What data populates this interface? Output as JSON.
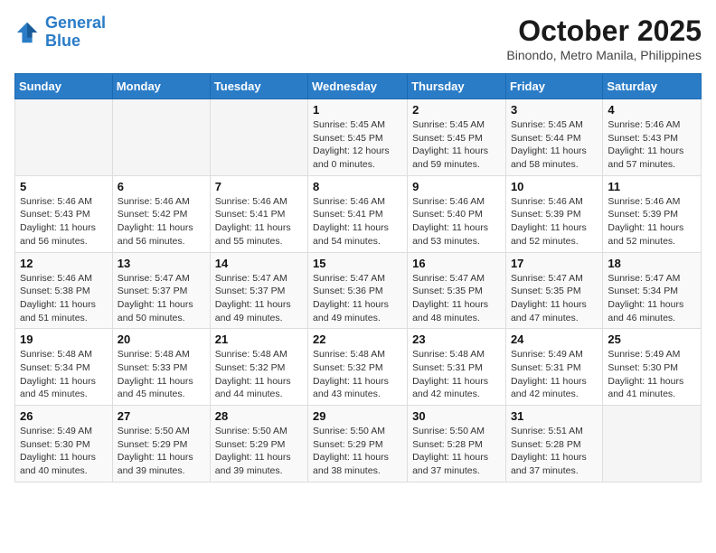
{
  "header": {
    "logo_line1": "General",
    "logo_line2": "Blue",
    "month": "October 2025",
    "location": "Binondo, Metro Manila, Philippines"
  },
  "weekdays": [
    "Sunday",
    "Monday",
    "Tuesday",
    "Wednesday",
    "Thursday",
    "Friday",
    "Saturday"
  ],
  "weeks": [
    [
      {
        "day": "",
        "info": ""
      },
      {
        "day": "",
        "info": ""
      },
      {
        "day": "",
        "info": ""
      },
      {
        "day": "1",
        "info": "Sunrise: 5:45 AM\nSunset: 5:45 PM\nDaylight: 12 hours\nand 0 minutes."
      },
      {
        "day": "2",
        "info": "Sunrise: 5:45 AM\nSunset: 5:45 PM\nDaylight: 11 hours\nand 59 minutes."
      },
      {
        "day": "3",
        "info": "Sunrise: 5:45 AM\nSunset: 5:44 PM\nDaylight: 11 hours\nand 58 minutes."
      },
      {
        "day": "4",
        "info": "Sunrise: 5:46 AM\nSunset: 5:43 PM\nDaylight: 11 hours\nand 57 minutes."
      }
    ],
    [
      {
        "day": "5",
        "info": "Sunrise: 5:46 AM\nSunset: 5:43 PM\nDaylight: 11 hours\nand 56 minutes."
      },
      {
        "day": "6",
        "info": "Sunrise: 5:46 AM\nSunset: 5:42 PM\nDaylight: 11 hours\nand 56 minutes."
      },
      {
        "day": "7",
        "info": "Sunrise: 5:46 AM\nSunset: 5:41 PM\nDaylight: 11 hours\nand 55 minutes."
      },
      {
        "day": "8",
        "info": "Sunrise: 5:46 AM\nSunset: 5:41 PM\nDaylight: 11 hours\nand 54 minutes."
      },
      {
        "day": "9",
        "info": "Sunrise: 5:46 AM\nSunset: 5:40 PM\nDaylight: 11 hours\nand 53 minutes."
      },
      {
        "day": "10",
        "info": "Sunrise: 5:46 AM\nSunset: 5:39 PM\nDaylight: 11 hours\nand 52 minutes."
      },
      {
        "day": "11",
        "info": "Sunrise: 5:46 AM\nSunset: 5:39 PM\nDaylight: 11 hours\nand 52 minutes."
      }
    ],
    [
      {
        "day": "12",
        "info": "Sunrise: 5:46 AM\nSunset: 5:38 PM\nDaylight: 11 hours\nand 51 minutes."
      },
      {
        "day": "13",
        "info": "Sunrise: 5:47 AM\nSunset: 5:37 PM\nDaylight: 11 hours\nand 50 minutes."
      },
      {
        "day": "14",
        "info": "Sunrise: 5:47 AM\nSunset: 5:37 PM\nDaylight: 11 hours\nand 49 minutes."
      },
      {
        "day": "15",
        "info": "Sunrise: 5:47 AM\nSunset: 5:36 PM\nDaylight: 11 hours\nand 49 minutes."
      },
      {
        "day": "16",
        "info": "Sunrise: 5:47 AM\nSunset: 5:35 PM\nDaylight: 11 hours\nand 48 minutes."
      },
      {
        "day": "17",
        "info": "Sunrise: 5:47 AM\nSunset: 5:35 PM\nDaylight: 11 hours\nand 47 minutes."
      },
      {
        "day": "18",
        "info": "Sunrise: 5:47 AM\nSunset: 5:34 PM\nDaylight: 11 hours\nand 46 minutes."
      }
    ],
    [
      {
        "day": "19",
        "info": "Sunrise: 5:48 AM\nSunset: 5:34 PM\nDaylight: 11 hours\nand 45 minutes."
      },
      {
        "day": "20",
        "info": "Sunrise: 5:48 AM\nSunset: 5:33 PM\nDaylight: 11 hours\nand 45 minutes."
      },
      {
        "day": "21",
        "info": "Sunrise: 5:48 AM\nSunset: 5:32 PM\nDaylight: 11 hours\nand 44 minutes."
      },
      {
        "day": "22",
        "info": "Sunrise: 5:48 AM\nSunset: 5:32 PM\nDaylight: 11 hours\nand 43 minutes."
      },
      {
        "day": "23",
        "info": "Sunrise: 5:48 AM\nSunset: 5:31 PM\nDaylight: 11 hours\nand 42 minutes."
      },
      {
        "day": "24",
        "info": "Sunrise: 5:49 AM\nSunset: 5:31 PM\nDaylight: 11 hours\nand 42 minutes."
      },
      {
        "day": "25",
        "info": "Sunrise: 5:49 AM\nSunset: 5:30 PM\nDaylight: 11 hours\nand 41 minutes."
      }
    ],
    [
      {
        "day": "26",
        "info": "Sunrise: 5:49 AM\nSunset: 5:30 PM\nDaylight: 11 hours\nand 40 minutes."
      },
      {
        "day": "27",
        "info": "Sunrise: 5:50 AM\nSunset: 5:29 PM\nDaylight: 11 hours\nand 39 minutes."
      },
      {
        "day": "28",
        "info": "Sunrise: 5:50 AM\nSunset: 5:29 PM\nDaylight: 11 hours\nand 39 minutes."
      },
      {
        "day": "29",
        "info": "Sunrise: 5:50 AM\nSunset: 5:29 PM\nDaylight: 11 hours\nand 38 minutes."
      },
      {
        "day": "30",
        "info": "Sunrise: 5:50 AM\nSunset: 5:28 PM\nDaylight: 11 hours\nand 37 minutes."
      },
      {
        "day": "31",
        "info": "Sunrise: 5:51 AM\nSunset: 5:28 PM\nDaylight: 11 hours\nand 37 minutes."
      },
      {
        "day": "",
        "info": ""
      }
    ]
  ]
}
